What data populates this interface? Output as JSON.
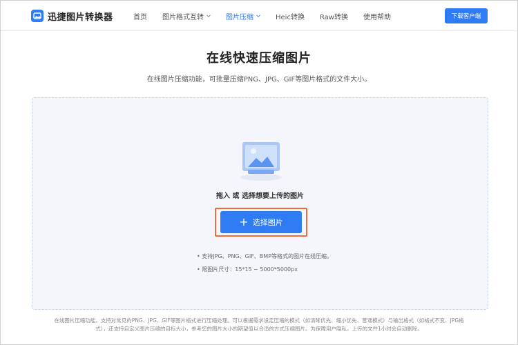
{
  "header": {
    "logo_text": "迅捷图片转换器",
    "nav": [
      {
        "label": "首页",
        "active": false,
        "dropdown": false
      },
      {
        "label": "图片格式互转",
        "active": false,
        "dropdown": true
      },
      {
        "label": "图片压缩",
        "active": true,
        "dropdown": true
      },
      {
        "label": "Heic转换",
        "active": false,
        "dropdown": false
      },
      {
        "label": "Raw转换",
        "active": false,
        "dropdown": false
      },
      {
        "label": "使用帮助",
        "active": false,
        "dropdown": false
      }
    ],
    "download_label": "下载客户端"
  },
  "page": {
    "title": "在线快速压缩图片",
    "subtitle": "在线图片压缩功能，可批量压缩PNG、JPG、GIF等图片格式的文件大小。"
  },
  "upload": {
    "hint": "拖入 或 选择想要上传的图片",
    "button_label": "选择图片",
    "rule_1": "• 支持JPG、PNG、GIF、BMP等格式的图片在线压缩。",
    "rule_2": "• 限图片尺寸：15*15 ~ 5000*5000px"
  },
  "footer_note": "在线图片压缩功能，支持对常见的PNG、JPG、GIF等图片格式进行压缩处理。可以根据需求设定压缩的模式（如清晰优先、缩小优先、普通模式）与输出格式（如格式不变、JPG格式），还支持自定义图片压缩的目标大小，参考您的图片大小的期望值以合适的方式压缩图片。为保障用户隐私，上传的文件1小时会自动删除。",
  "colors": {
    "accent": "#2f7bf4",
    "highlight_outline": "#f06b3c",
    "dropzone_bg": "#f4f6fb"
  }
}
